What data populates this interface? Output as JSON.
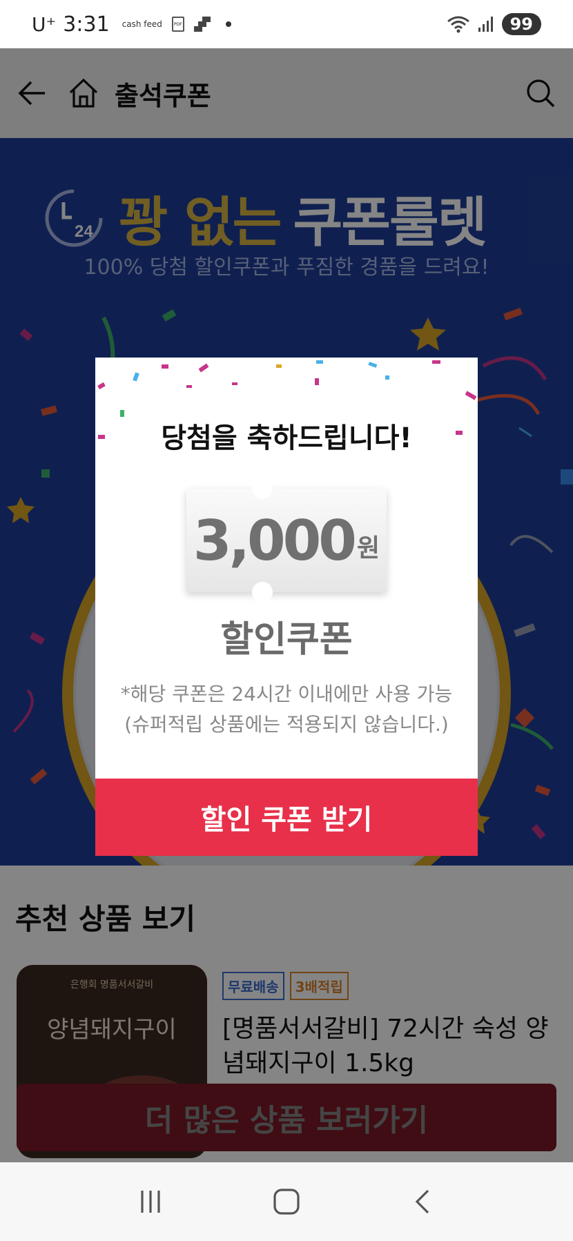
{
  "status_bar": {
    "carrier": "U⁺",
    "time": "3:31",
    "app_label": "cash feed",
    "pdf_label": "PDF",
    "battery": "99"
  },
  "app_bar": {
    "title": "출석쿠폰",
    "back_icon": "back-arrow-icon",
    "home_icon": "home-icon",
    "search_icon": "search-icon"
  },
  "banner": {
    "clock_label": "24",
    "headline_gold": "꽝 없는",
    "headline_white": "쿠폰룰렛",
    "subtitle": "100% 당첨 할인쿠폰과 푸짐한 경품을 드려요!"
  },
  "modal": {
    "title": "당첨을 축하드립니다!",
    "amount": "3,000",
    "currency": "원",
    "coupon_type": "할인쿠폰",
    "note_line1": "*해당 쿠폰은 24시간 이내에만 사용 가능",
    "note_line2": "(슈퍼적립 상품에는 적용되지 않습니다.)",
    "button_label": "할인 쿠폰 받기"
  },
  "recommend": {
    "section_title": "추천 상품 보기",
    "product": {
      "thumb_brand": "은행회 명품서서갈비",
      "thumb_name": "양념돼지구이",
      "badges": [
        "무료배송",
        "3배적립"
      ],
      "name": "[명품서서갈비] 72시간 숙성 양념돼지구이 1.5kg"
    }
  },
  "bottom_cta": {
    "label": "더 많은 상품 보러가기"
  },
  "colors": {
    "accent_red": "#e8304a",
    "banner_blue": "#1e3f9a",
    "gold": "#d9b443"
  }
}
